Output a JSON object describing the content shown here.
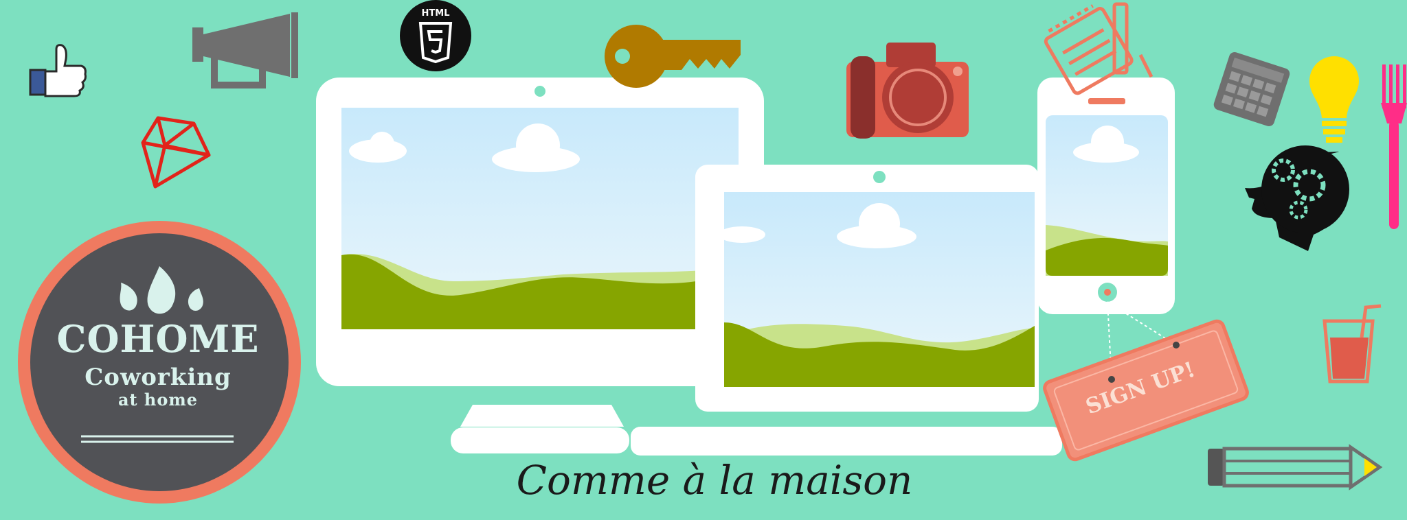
{
  "brand": {
    "name": "COHOME",
    "subtitle": "Coworking",
    "subtitle2": "at home"
  },
  "tagline": "Comme à la maison",
  "badge": {
    "html_label": "HTML"
  },
  "cta": {
    "signup_label": "SIGN UP!"
  },
  "colors": {
    "background": "#7de0c0",
    "badge_ring": "#ef7a60",
    "badge_fill": "#515256",
    "signup_fill": "#f2907a"
  },
  "icons": [
    "thumbs-up-icon",
    "megaphone-icon",
    "ruby-gem-icon",
    "html5-icon",
    "key-icon",
    "camera-icon",
    "notepad-pencil-icon",
    "calculator-icon",
    "lightbulb-icon",
    "fork-icon",
    "head-gears-icon",
    "drink-glass-icon",
    "pencil-icon"
  ]
}
